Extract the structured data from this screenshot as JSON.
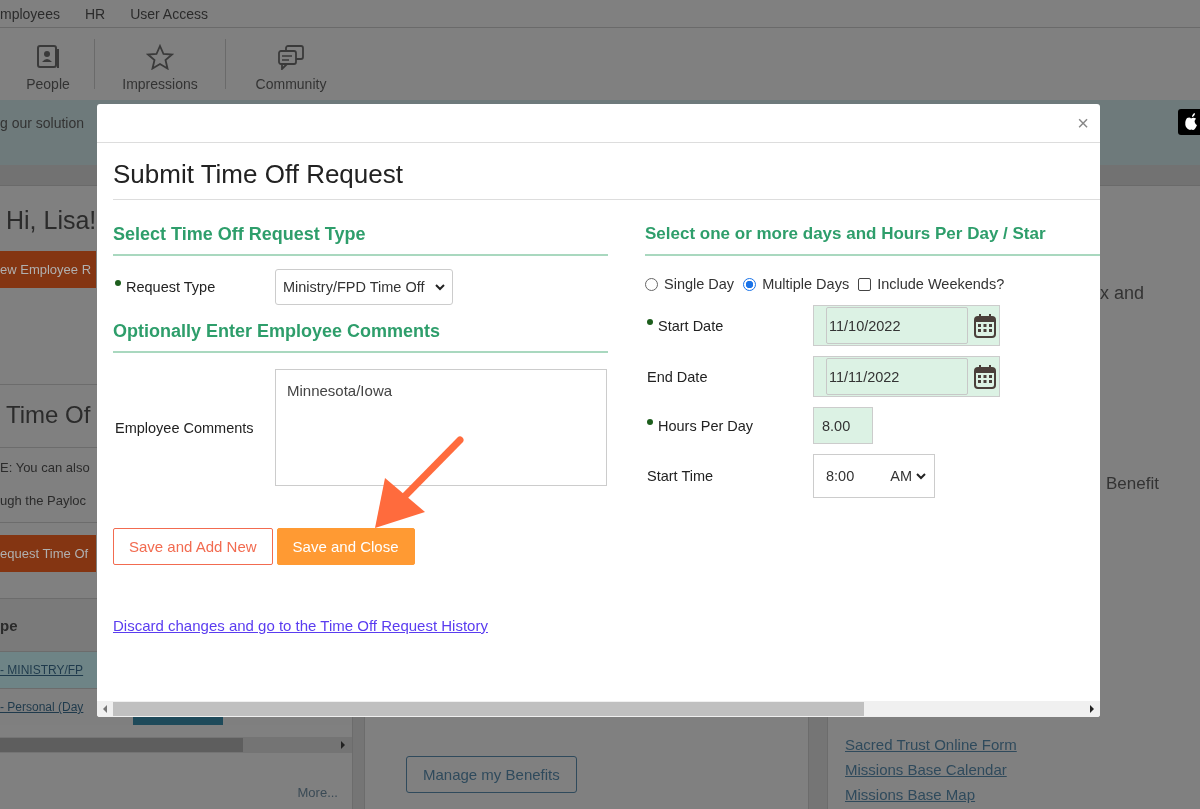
{
  "top_nav": {
    "items": [
      "mployees",
      "HR",
      "User Access"
    ]
  },
  "toolbar": [
    {
      "label": "People",
      "kind": "people"
    },
    {
      "label": "Impressions",
      "kind": "impressions"
    },
    {
      "label": "Community",
      "kind": "community"
    }
  ],
  "banner": {
    "text": "g our solution"
  },
  "left_panel": {
    "greeting": "Hi, Lisa!",
    "new_employee_button": "ew Employee R",
    "section_title": "Time Of",
    "notes": [
      "E: You can also",
      "ugh the Payloc"
    ],
    "request_button": "equest Time Of",
    "table": {
      "column_1": "pe",
      "rows": [
        {
          "type": "- MINISTRY/FP",
          "selected": true
        },
        {
          "type": "- Personal (Day",
          "selected": false
        }
      ]
    },
    "more_link": "More..."
  },
  "middle_panel": {
    "button": "Manage my Benefits"
  },
  "right_panel": {
    "fragments": [
      "x and",
      "Benefit"
    ],
    "links": [
      "Sacred Trust Online Form",
      "Missions Base Calendar",
      "Missions Base Map"
    ]
  },
  "modal": {
    "close": "×",
    "title": "Submit Time Off Request",
    "type_section": {
      "heading": "Select Time Off Request Type",
      "label": "Request Type",
      "required": true,
      "value": "Ministry/FPD Time Off"
    },
    "comments_section": {
      "heading": "Optionally Enter Employee Comments",
      "label": "Employee Comments",
      "value": "Minnesota/Iowa"
    },
    "buttons": [
      {
        "label": "Save and Add New",
        "kind": "secondary"
      },
      {
        "label": "Save and Close",
        "kind": "primary"
      }
    ],
    "discard_link": "Discard changes and go to the Time Off Request History",
    "days_section": {
      "heading": "Select one or more days and Hours Per Day / Star",
      "options": [
        {
          "label": "Single Day",
          "kind": "radio",
          "selected": false
        },
        {
          "label": "Multiple Days",
          "kind": "radio",
          "selected": true
        },
        {
          "label": "Include Weekends?",
          "kind": "checkbox",
          "checked": false
        }
      ],
      "fields": [
        {
          "label": "Start Date",
          "required": true,
          "kind": "date",
          "value": "11/10/2022"
        },
        {
          "label": "End Date",
          "required": false,
          "kind": "date",
          "value": "11/11/2022"
        },
        {
          "label": "Hours Per Day",
          "required": true,
          "kind": "number",
          "value": "8.00"
        },
        {
          "label": "Start Time",
          "required": false,
          "kind": "time",
          "value": "8:00",
          "period": "AM"
        }
      ]
    }
  }
}
